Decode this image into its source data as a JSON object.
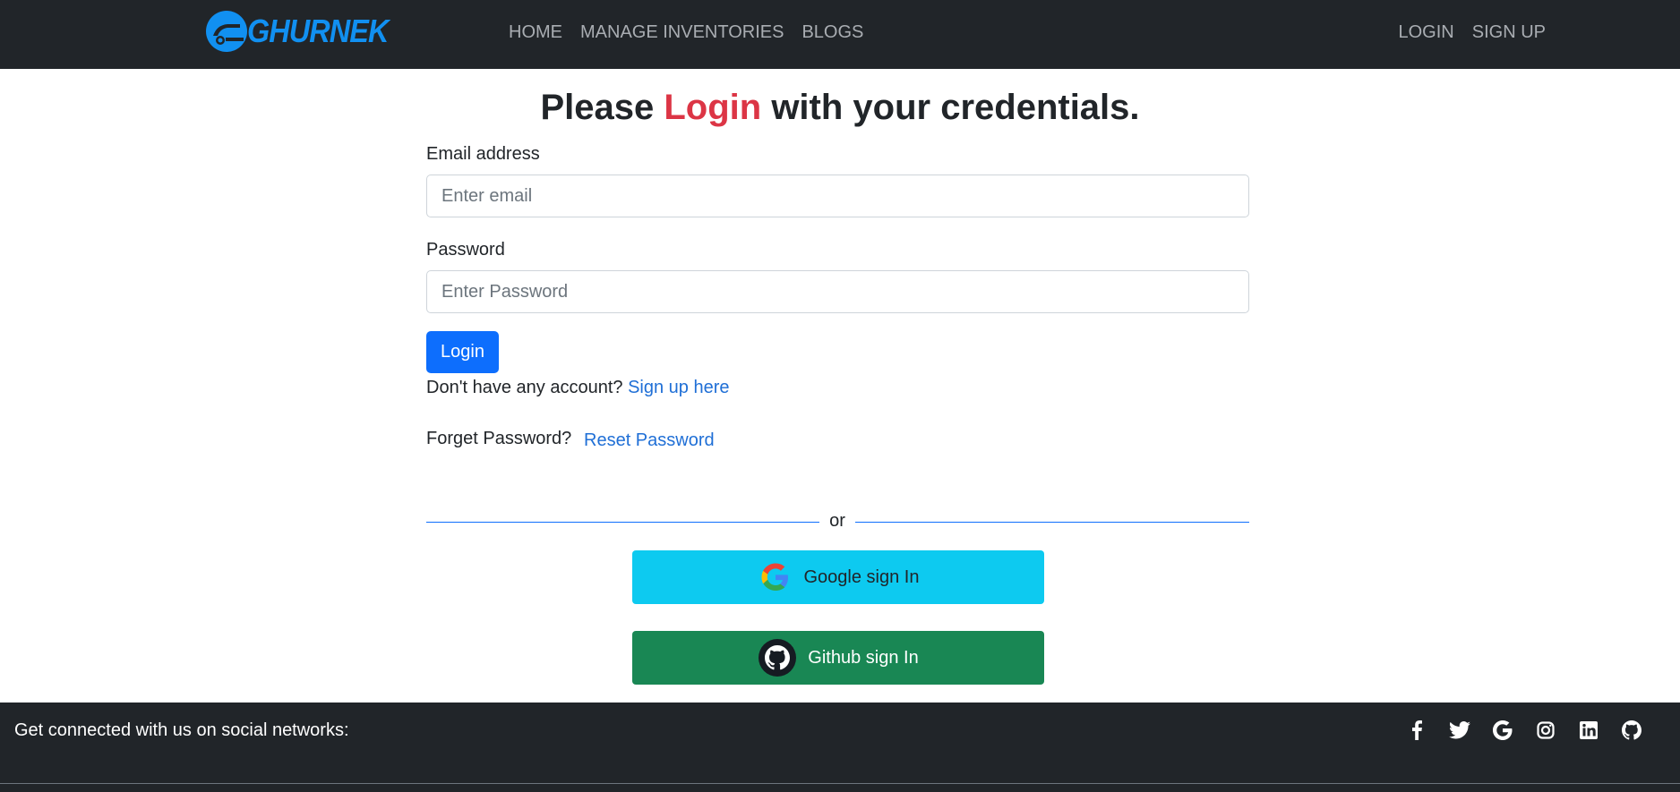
{
  "navbar": {
    "brand": "GHURNEK",
    "links": [
      "HOME",
      "MANAGE INVENTORIES",
      "BLOGS"
    ],
    "right_links": [
      "LOGIN",
      "SIGN UP"
    ]
  },
  "heading": {
    "prefix": "Please ",
    "accent": "Login",
    "suffix": " with your credentials."
  },
  "form": {
    "email_label": "Email address",
    "email_placeholder": "Enter email",
    "email_value": "",
    "password_label": "Password",
    "password_placeholder": "Enter Password",
    "password_value": "",
    "login_button": "Login",
    "signup_prompt": "Don't have any account? ",
    "signup_link": "Sign up here",
    "forget_prompt": "Forget Password?",
    "reset_link": "Reset Password",
    "divider_text": "or",
    "google_button": "Google sign In",
    "github_button": "Github sign In"
  },
  "footer": {
    "text": "Get connected with us on social networks:",
    "icons": [
      "facebook-icon",
      "twitter-icon",
      "google-icon",
      "instagram-icon",
      "linkedin-icon",
      "github-icon"
    ]
  },
  "colors": {
    "navbar_bg": "#212529",
    "brand": "#1190f1",
    "accent_red": "#dc3545",
    "primary": "#0d6efd",
    "info": "#0dcaf0",
    "success": "#198754"
  }
}
